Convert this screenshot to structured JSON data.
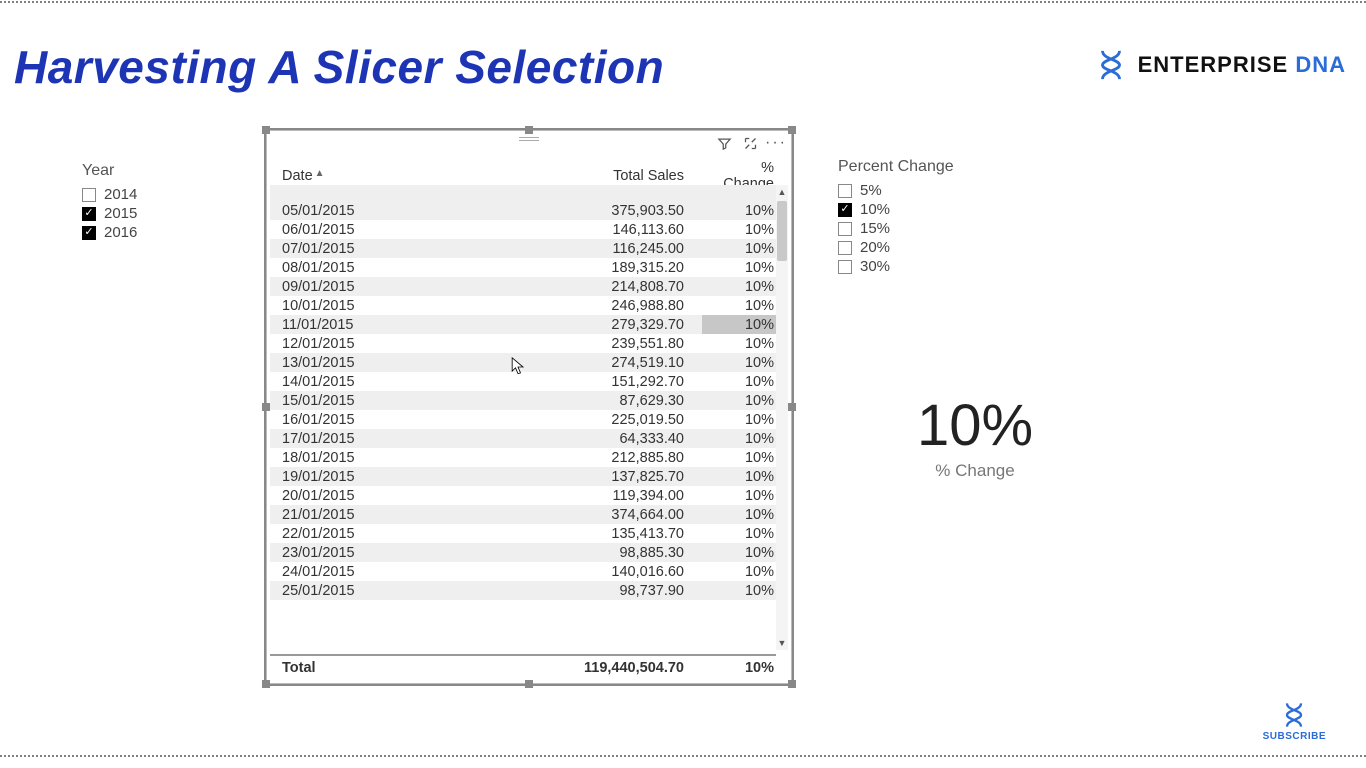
{
  "header": {
    "title": "Harvesting A Slicer Selection"
  },
  "logo": {
    "word1": "ENTERPRISE",
    "word2": "DNA"
  },
  "subscribe": {
    "label": "SUBSCRIBE"
  },
  "year_slicer": {
    "title": "Year",
    "items": [
      {
        "label": "2014",
        "checked": false
      },
      {
        "label": "2015",
        "checked": true
      },
      {
        "label": "2016",
        "checked": true
      }
    ]
  },
  "pct_slicer": {
    "title": "Percent Change",
    "items": [
      {
        "label": "5%",
        "checked": false
      },
      {
        "label": "10%",
        "checked": true
      },
      {
        "label": "15%",
        "checked": false
      },
      {
        "label": "20%",
        "checked": false
      },
      {
        "label": "30%",
        "checked": false
      }
    ]
  },
  "table": {
    "columns": {
      "c0": "Date",
      "c1": "Total Sales",
      "c2": "% Change"
    },
    "rows": [
      {
        "date": "05/01/2015",
        "sales": "375,903.50",
        "pct": "10%"
      },
      {
        "date": "06/01/2015",
        "sales": "146,113.60",
        "pct": "10%"
      },
      {
        "date": "07/01/2015",
        "sales": "116,245.00",
        "pct": "10%"
      },
      {
        "date": "08/01/2015",
        "sales": "189,315.20",
        "pct": "10%"
      },
      {
        "date": "09/01/2015",
        "sales": "214,808.70",
        "pct": "10%"
      },
      {
        "date": "10/01/2015",
        "sales": "246,988.80",
        "pct": "10%"
      },
      {
        "date": "11/01/2015",
        "sales": "279,329.70",
        "pct": "10%"
      },
      {
        "date": "12/01/2015",
        "sales": "239,551.80",
        "pct": "10%"
      },
      {
        "date": "13/01/2015",
        "sales": "274,519.10",
        "pct": "10%"
      },
      {
        "date": "14/01/2015",
        "sales": "151,292.70",
        "pct": "10%"
      },
      {
        "date": "15/01/2015",
        "sales": "87,629.30",
        "pct": "10%"
      },
      {
        "date": "16/01/2015",
        "sales": "225,019.50",
        "pct": "10%"
      },
      {
        "date": "17/01/2015",
        "sales": "64,333.40",
        "pct": "10%"
      },
      {
        "date": "18/01/2015",
        "sales": "212,885.80",
        "pct": "10%"
      },
      {
        "date": "19/01/2015",
        "sales": "137,825.70",
        "pct": "10%"
      },
      {
        "date": "20/01/2015",
        "sales": "119,394.00",
        "pct": "10%"
      },
      {
        "date": "21/01/2015",
        "sales": "374,664.00",
        "pct": "10%"
      },
      {
        "date": "22/01/2015",
        "sales": "135,413.70",
        "pct": "10%"
      },
      {
        "date": "23/01/2015",
        "sales": "98,885.30",
        "pct": "10%"
      },
      {
        "date": "24/01/2015",
        "sales": "140,016.60",
        "pct": "10%"
      },
      {
        "date": "25/01/2015",
        "sales": "98,737.90",
        "pct": "10%"
      }
    ],
    "total": {
      "label": "Total",
      "sales": "119,440,504.70",
      "pct": "10%"
    }
  },
  "card": {
    "value": "10%",
    "label": "% Change"
  }
}
